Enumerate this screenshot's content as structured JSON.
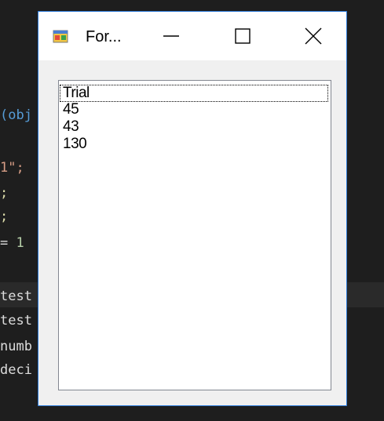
{
  "editor": {
    "lines": [
      {
        "text": "(obj",
        "color": "#569cd6"
      },
      {
        "text": "1\";",
        "color": "#d69d85"
      },
      {
        "text": ";",
        "color": "#dcdcaa"
      },
      {
        "text": ";",
        "color": "#dcdcaa"
      },
      {
        "text": " = 1",
        "color": "#b5cea8"
      },
      {
        "text": "test",
        "color": "#dcdcdc"
      },
      {
        "text": "test",
        "color": "#dcdcdc"
      },
      {
        "text": "numb",
        "color": "#dcdcdc"
      },
      {
        "text": "deci",
        "color": "#dcdcdc"
      }
    ]
  },
  "window": {
    "title": "For...",
    "icon": "winforms-app-icon",
    "controls": {
      "minimize": "minimize-icon",
      "maximize": "maximize-icon",
      "close": "close-icon"
    },
    "border_color": "#2b79d8"
  },
  "listbox": {
    "items": [
      "Trial",
      "45",
      "43",
      "130"
    ],
    "focused_index": 0
  }
}
